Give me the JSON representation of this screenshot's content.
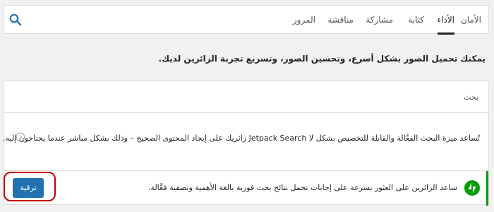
{
  "tabs": [
    {
      "label": "الأمان"
    },
    {
      "label": "الأداء",
      "active": true
    },
    {
      "label": "كتابة"
    },
    {
      "label": "مشاركة"
    },
    {
      "label": "مناقشة"
    },
    {
      "label": "المرور"
    }
  ],
  "search": {
    "icon": "search-icon"
  },
  "intro_text": "يمكنك تحميل الصور بشكل أسرع، وتحسين الصور، وتسريع تجربة الزائرين لديك.",
  "card": {
    "title": "بحث",
    "description": "تُساعد ميزة البحث الفعَّالة والقابلة للتخصيص بشكل لا Jetpack Search زائريك على إيجاد المحتوى الصحيح – وذلك بشكل مباشر عندما يحتاجون إليه.",
    "info_icon": "info-icon"
  },
  "footer": {
    "text": "ساعد الزائرين على العثور بسرعة على إجابات تحمل نتائج بحث فورية بالغة الأهمية وتصفية فعَّالة.",
    "upgrade_label": "ترقية",
    "logo_icon": "jetpack-logo-icon"
  },
  "colors": {
    "accent": "#069e08",
    "primary_button": "#2271b1",
    "highlight": "#c00000"
  }
}
